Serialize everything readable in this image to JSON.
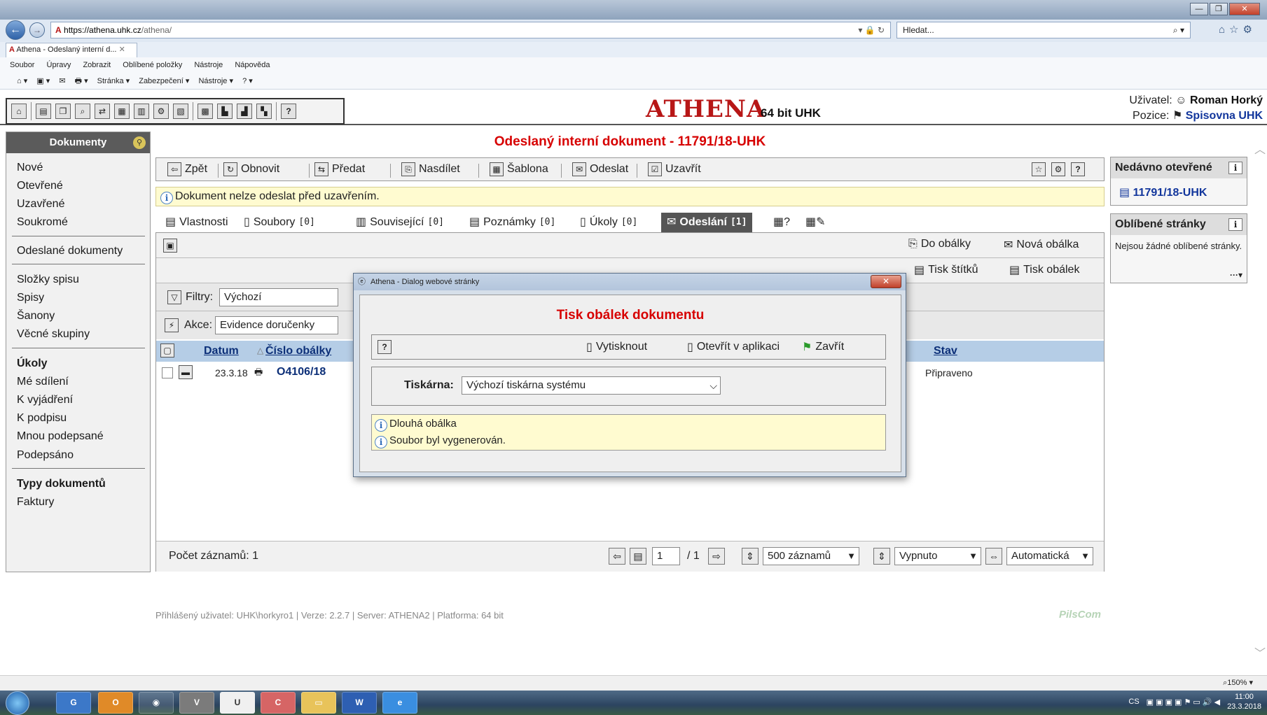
{
  "browser": {
    "tab_title": "Athena - Odeslaný interní d...",
    "url_host": "https://athena.uhk.cz",
    "url_path": "/athena/",
    "search_placeholder": "Hledat...",
    "menu": [
      "Soubor",
      "Úpravy",
      "Zobrazit",
      "Oblíbené položky",
      "Nástroje",
      "Nápověda"
    ],
    "command_bar": [
      "Stránka ▾",
      "Zabezpečení ▾",
      "Nástroje ▾"
    ],
    "zoom": "150%"
  },
  "header": {
    "logo": "ATHENA",
    "logo_sub": "64 bit UHK",
    "user_label": "Uživatel:",
    "user_name": "Roman Horký",
    "position_label": "Pozice:",
    "position_value": "Spisovna UHK"
  },
  "sidebar": {
    "title": "Dokumenty",
    "items": [
      {
        "label": "Nové"
      },
      {
        "label": "Otevřené"
      },
      {
        "label": "Uzavřené"
      },
      {
        "label": "Soukromé"
      },
      {
        "label": "Odeslané dokumenty"
      },
      {
        "label": "Složky spisu"
      },
      {
        "label": "Spisy"
      },
      {
        "label": "Šanony"
      },
      {
        "label": "Věcné skupiny"
      },
      {
        "label": "Úkoly"
      },
      {
        "label": "Mé sdílení"
      },
      {
        "label": "K vyjádření"
      },
      {
        "label": "K podpisu"
      },
      {
        "label": "Mnou podepsané"
      },
      {
        "label": "Podepsáno"
      },
      {
        "label": "Typy dokumentů"
      },
      {
        "label": "Faktury"
      }
    ]
  },
  "main": {
    "title": "Odeslaný interní dokument - 11791/18-UHK",
    "toolbar": [
      "Zpět",
      "Obnovit",
      "Předat",
      "Nasdílet",
      "Šablona",
      "Odeslat",
      "Uzavřít"
    ],
    "notice": "Dokument nelze odeslat před uzavřením.",
    "tabs": [
      {
        "label": "Vlastnosti",
        "count": ""
      },
      {
        "label": "Soubory",
        "count": "[0]"
      },
      {
        "label": "Související",
        "count": "[0]"
      },
      {
        "label": "Poznámky",
        "count": "[0]"
      },
      {
        "label": "Úkoly",
        "count": "[0]"
      },
      {
        "label": "Odeslání",
        "count": "[1]"
      }
    ],
    "panel_actions": [
      "Do obálky",
      "Nová obálka",
      "Tisk štítků",
      "Tisk obálek"
    ],
    "filter_label": "Filtry:",
    "filter_value": "Výchozí",
    "action_label": "Akce:",
    "action_value": "Evidence doručenky",
    "columns": [
      "Datum",
      "Číslo obálky",
      "Stav"
    ],
    "rows": [
      {
        "date": "23.3.18",
        "number": "O4106/18",
        "status": "Připraveno"
      }
    ],
    "footer": {
      "count_label": "Počet záznamů: 1",
      "page": "1",
      "page_total": "/ 1",
      "page_size": "500 záznamů",
      "filter_mode": "Vypnuto",
      "refresh_mode": "Automatická"
    },
    "statusline": "Přihlášený uživatel: UHK\\horkyro1  |  Verze: 2.2.7  |  Server: ATHENA2  |  Platforma: 64 bit",
    "brand": "PilsCom"
  },
  "right": {
    "recent_title": "Nedávno otevřené",
    "recent_item": "11791/18-UHK",
    "fav_title": "Oblíbené stránky",
    "fav_text": "Nejsou žádné oblíbené stránky."
  },
  "dialog": {
    "window_title": "Athena - Dialog webové stránky",
    "heading": "Tisk obálek dokumentu",
    "print": "Vytisknout",
    "open_app": "Otevřít v aplikaci",
    "close": "Zavřít",
    "printer_label": "Tiskárna:",
    "printer_value": "Výchozí tiskárna systému",
    "messages": [
      "Dlouhá obálka",
      "Soubor byl vygenerován."
    ]
  },
  "taskbar": {
    "lang": "CS",
    "time": "11:00",
    "date": "23.3.2018"
  }
}
